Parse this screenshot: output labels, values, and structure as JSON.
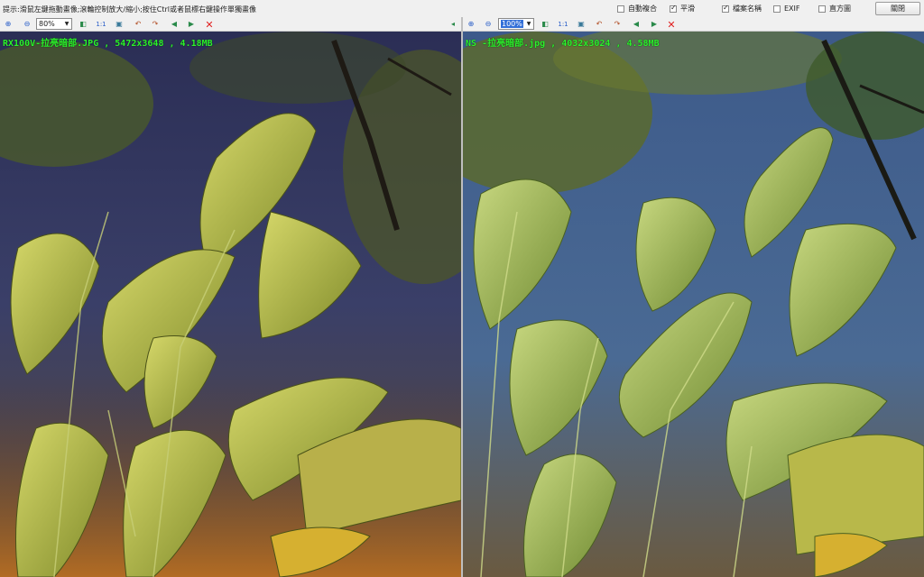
{
  "hint": "提示:滑鼠左鍵拖動畫像;滾輪控制放大/縮小;按住Ctrl或者鼠標右鍵操作單獨畫像",
  "options": [
    {
      "label": "自動複合",
      "checked": false
    },
    {
      "label": "平滑",
      "checked": true
    },
    {
      "label": "檔案名稱",
      "checked": true
    },
    {
      "label": "EXIF",
      "checked": false
    },
    {
      "label": "直方圖",
      "checked": false
    }
  ],
  "close_label": "關閉",
  "left_pane": {
    "zoom": "80%",
    "one_to_one": "1:1",
    "caption": "RX100V-拉亮暗部.JPG , 5472x3648 , 4.18MB"
  },
  "right_pane": {
    "zoom": "100%",
    "one_to_one": "1:1",
    "caption": "NS -拉亮暗部.jpg , 4032x3024 , 4.58MB"
  },
  "icons": [
    "zoom-in-icon",
    "zoom-out-icon",
    "fit-icon",
    "actual-size-icon",
    "screen-fit-icon",
    "rotate-left-icon",
    "rotate-right-icon",
    "previous-icon",
    "next-icon",
    "delete-icon"
  ],
  "colors": {
    "caption": "#2cf22c",
    "delete": "#e02020",
    "sky_left": "#2b2e55",
    "sky_right": "#3d5a8a"
  }
}
